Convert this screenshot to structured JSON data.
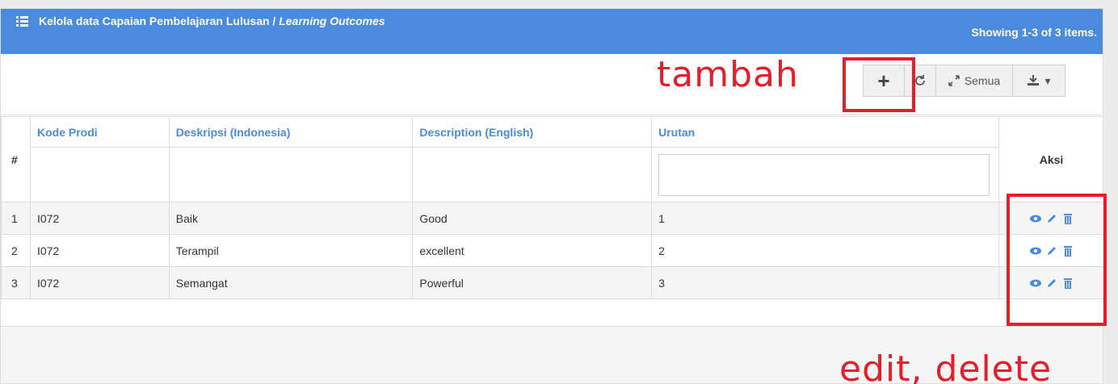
{
  "header": {
    "title": "Kelola data Capaian Pembelajaran Lulusan / ",
    "title_italic": "Learning Outcomes",
    "summary": "Showing 1-3 of 3 items."
  },
  "toolbar": {
    "annotation": "tambah",
    "add_label": "+",
    "refresh_label": "C",
    "all_label": "Semua",
    "export_label": "▾"
  },
  "table": {
    "columns": [
      "Kode Prodi",
      "Deskripsi (Indonesia)",
      "Description (English)",
      "Urutan"
    ],
    "num_header": "#",
    "action_header": "Aksi",
    "rows": [
      {
        "num": "1",
        "kode": "I072",
        "deskripsi": "Baik",
        "description": "Good",
        "urutan": "1"
      },
      {
        "num": "2",
        "kode": "I072",
        "deskripsi": "Terampil",
        "description": "excellent",
        "urutan": "2"
      },
      {
        "num": "3",
        "kode": "I072",
        "deskripsi": "Semangat",
        "description": "Powerful",
        "urutan": "3"
      }
    ]
  },
  "annotations": {
    "actions_label": "edit, delete"
  },
  "colors": {
    "header_bg": "#4a8bde",
    "annotation_red": "#e41f2b"
  }
}
